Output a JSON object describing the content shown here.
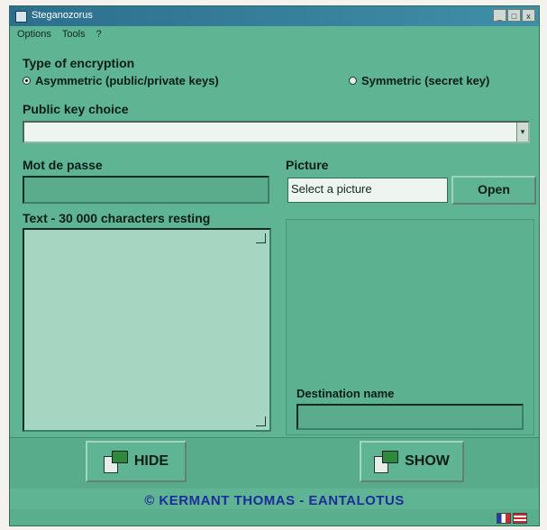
{
  "window": {
    "title": "Steganozorus",
    "min": "_",
    "max": "□",
    "close": "x"
  },
  "menu": [
    "Options",
    "Tools",
    "?"
  ],
  "encryption": {
    "label": "Type of encryption",
    "asymmetric": "Asymmetric (public/private keys)",
    "symmetric": "Symmetric (secret key)",
    "selected": "asymmetric"
  },
  "public_key": {
    "label": "Public key choice",
    "value": ""
  },
  "password": {
    "label": "Mot de passe",
    "value": ""
  },
  "text": {
    "label": "Text - 30 000 characters resting",
    "value": ""
  },
  "picture": {
    "label": "Picture",
    "value": "Select a picture",
    "open_label": "Open"
  },
  "destination": {
    "label": "Destination name",
    "value": ""
  },
  "actions": {
    "hide": "HIDE",
    "show": "SHOW"
  },
  "copyright": "© KERMANT THOMAS - EANTALOTUS",
  "colors": {
    "window_bg": "#5fb493",
    "title_bar": "#2d6e8e",
    "copyright": "#1d2e9a"
  },
  "icons": [
    "window-app-icon",
    "dropdown-arrow-icon",
    "hide-icon",
    "show-icon",
    "french-flag-icon",
    "us-flag-icon"
  ]
}
